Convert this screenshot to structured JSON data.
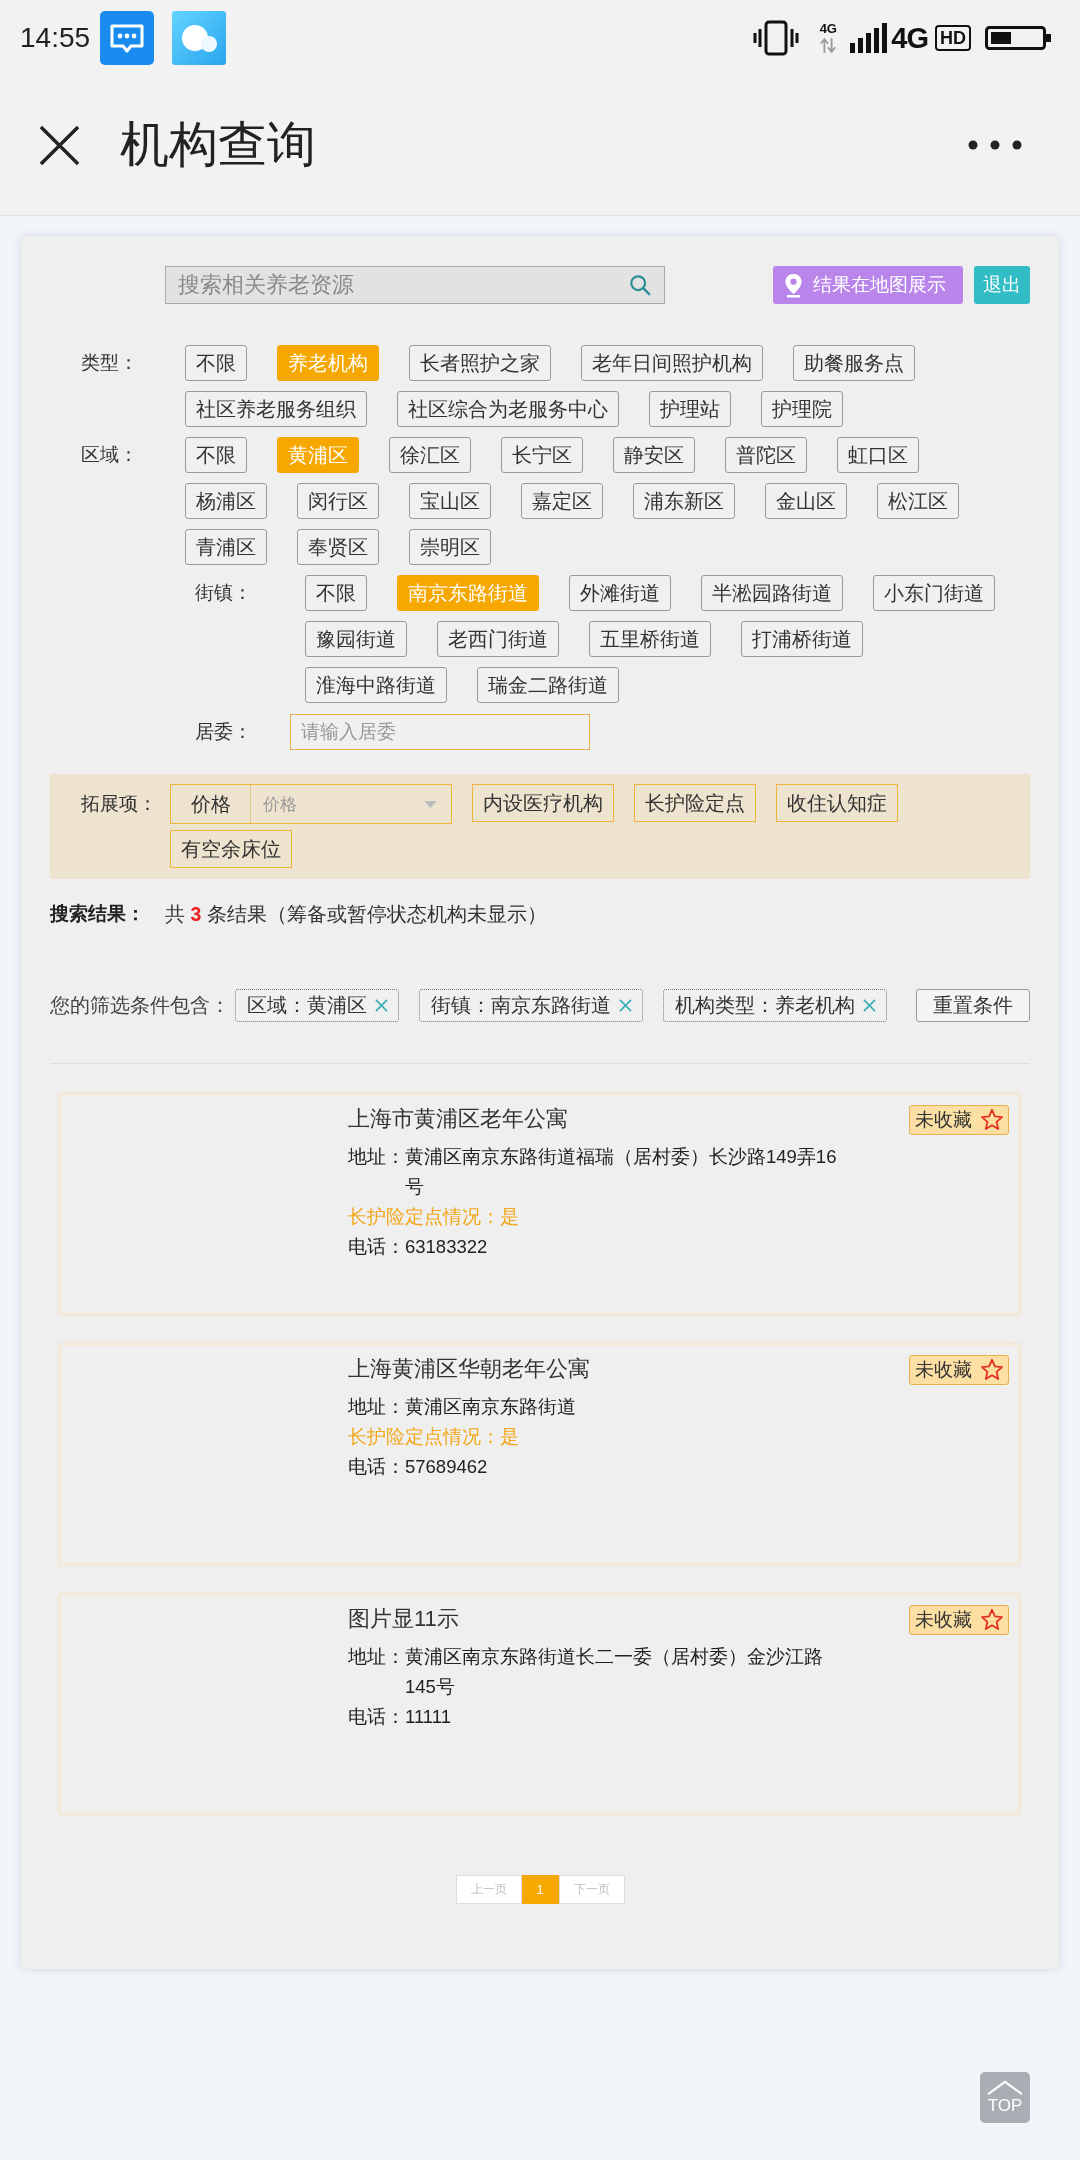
{
  "status_bar": {
    "time": "14:55",
    "data_label": "4G",
    "network_label": "4G",
    "hd_label": "HD"
  },
  "header": {
    "title": "机构查询"
  },
  "search": {
    "placeholder": "搜索相关养老资源",
    "map_button": "结果在地图展示",
    "exit_button": "退出"
  },
  "filters": [
    {
      "label": "类型：",
      "options": [
        {
          "label": "不限",
          "selected": false
        },
        {
          "label": "养老机构",
          "selected": true
        },
        {
          "label": "长者照护之家",
          "selected": false
        },
        {
          "label": "老年日间照护机构",
          "selected": false
        },
        {
          "label": "助餐服务点",
          "selected": false
        },
        {
          "label": "社区养老服务组织",
          "selected": false
        },
        {
          "label": "社区综合为老服务中心",
          "selected": false
        },
        {
          "label": "护理站",
          "selected": false
        },
        {
          "label": "护理院",
          "selected": false
        }
      ]
    },
    {
      "label": "区域：",
      "options": [
        {
          "label": "不限",
          "selected": false
        },
        {
          "label": "黄浦区",
          "selected": true
        },
        {
          "label": "徐汇区",
          "selected": false
        },
        {
          "label": "长宁区",
          "selected": false
        },
        {
          "label": "静安区",
          "selected": false
        },
        {
          "label": "普陀区",
          "selected": false
        },
        {
          "label": "虹口区",
          "selected": false
        },
        {
          "label": "杨浦区",
          "selected": false
        },
        {
          "label": "闵行区",
          "selected": false
        },
        {
          "label": "宝山区",
          "selected": false
        },
        {
          "label": "嘉定区",
          "selected": false
        },
        {
          "label": "浦东新区",
          "selected": false
        },
        {
          "label": "金山区",
          "selected": false
        },
        {
          "label": "松江区",
          "selected": false
        },
        {
          "label": "青浦区",
          "selected": false
        },
        {
          "label": "奉贤区",
          "selected": false
        },
        {
          "label": "崇明区",
          "selected": false
        }
      ]
    }
  ],
  "street": {
    "label": "街镇：",
    "options": [
      {
        "label": "不限",
        "selected": false
      },
      {
        "label": "南京东路街道",
        "selected": true
      },
      {
        "label": "外滩街道",
        "selected": false
      },
      {
        "label": "半淞园路街道",
        "selected": false
      },
      {
        "label": "小东门街道",
        "selected": false
      },
      {
        "label": "豫园街道",
        "selected": false
      },
      {
        "label": "老西门街道",
        "selected": false
      },
      {
        "label": "五里桥街道",
        "selected": false
      },
      {
        "label": "打浦桥街道",
        "selected": false
      },
      {
        "label": "淮海中路街道",
        "selected": false
      },
      {
        "label": "瑞金二路街道",
        "selected": false
      }
    ]
  },
  "committee": {
    "label": "居委：",
    "placeholder": "请输入居委"
  },
  "extensions": {
    "label": "拓展项：",
    "items": [
      {
        "kind": "select",
        "label": "价格",
        "placeholder": "价格"
      },
      {
        "kind": "toggle",
        "label": "内设医疗机构",
        "selected": false
      },
      {
        "kind": "toggle",
        "label": "长护险定点",
        "selected": false
      },
      {
        "kind": "toggle",
        "label": "收住认知症",
        "selected": false
      },
      {
        "kind": "toggle",
        "label": "有空余床位",
        "selected": false
      }
    ]
  },
  "results": {
    "label": "搜索结果：",
    "summary": "共 **3** 条结果（筹备或暂停状态机构未显示）"
  },
  "conditions": {
    "label": "您的筛选条件包含：",
    "chips": [
      "区域：黄浦区",
      "街镇：南京东路街道",
      "机构类型：养老机构"
    ],
    "reset_button": "重置条件"
  },
  "institutions": [
    {
      "name": "上海市黄浦区老年公寓",
      "address_label": "地址：",
      "address": "黄浦区南京东路街道福瑞（居村委）长沙路149弄16号",
      "insurance": "长护险定点情况：是",
      "phone_label": "电话：",
      "phone": "63183322",
      "favorite_label": "未收藏",
      "favorited": false
    },
    {
      "name": "上海黄浦区华朝老年公寓",
      "address_label": "地址：",
      "address": "黄浦区南京东路街道",
      "insurance": "长护险定点情况：是",
      "phone_label": "电话：",
      "phone": "57689462",
      "favorite_label": "未收藏",
      "favorited": false
    },
    {
      "name": "图片显11示",
      "address_label": "地址：",
      "address": "黄浦区南京东路街道长二一委（居村委）金沙江路145号",
      "phone_label": "电话：",
      "phone": "11111",
      "favorite_label": "未收藏",
      "favorited": false
    }
  ],
  "pagination": {
    "prev": "上一页",
    "pages": [
      {
        "label": "1",
        "selected": true
      }
    ],
    "next": "下一页"
  },
  "back_to_top": "TOP"
}
